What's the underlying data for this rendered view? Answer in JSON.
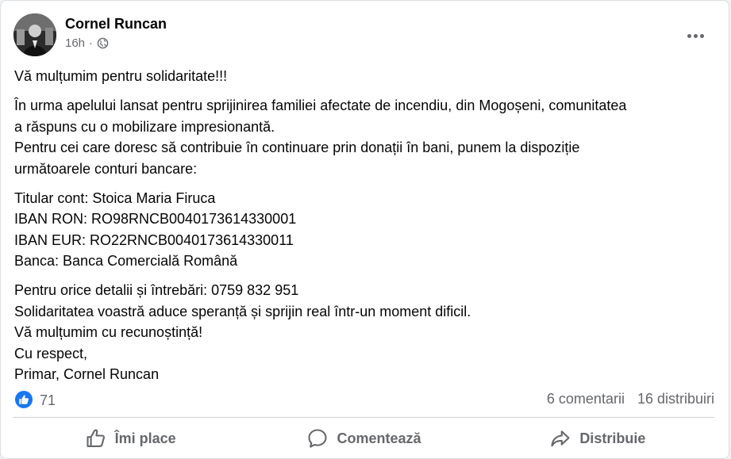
{
  "post": {
    "author": "Cornel Runcan",
    "timestamp": "16h",
    "separator": "·",
    "audience_icon": "globe-icon",
    "more_icon": "more-options-icon",
    "paragraphs": [
      [
        "Vă mulțumim pentru solidaritate!!!"
      ],
      [
        "În urma apelului lansat pentru sprijinirea familiei afectate de incendiu, din Mogoșeni, comunitatea",
        "a răspuns cu o mobilizare impresionantă.",
        "Pentru cei care doresc să contribuie în continuare prin donații în bani, punem la dispoziție",
        "următoarele conturi bancare:"
      ],
      [
        "Titular cont: Stoica Maria Firuca",
        "IBAN RON: RO98RNCB0040173614330001",
        "IBAN EUR: RO22RNCB0040173614330011",
        "Banca: Banca Comercială Română"
      ],
      [
        "Pentru orice detalii și întrebări: 0759 832 951",
        "Solidaritatea voastră aduce speranță și sprijin real într-un moment dificil.",
        "Vă mulțumim cu recunoștință!",
        "Cu respect,",
        "Primar, Cornel Runcan"
      ]
    ]
  },
  "stats": {
    "reaction_icon": "like-reaction-icon",
    "likes": "71",
    "comments": "6 comentarii",
    "shares": "16 distribuiri"
  },
  "actions": {
    "like_label": "Îmi place",
    "comment_label": "Comentează",
    "share_label": "Distribuie"
  },
  "colors": {
    "accent": "#1877f2",
    "secondary_text": "#65676b",
    "primary_text": "#050505",
    "divider": "#ced0d4"
  }
}
